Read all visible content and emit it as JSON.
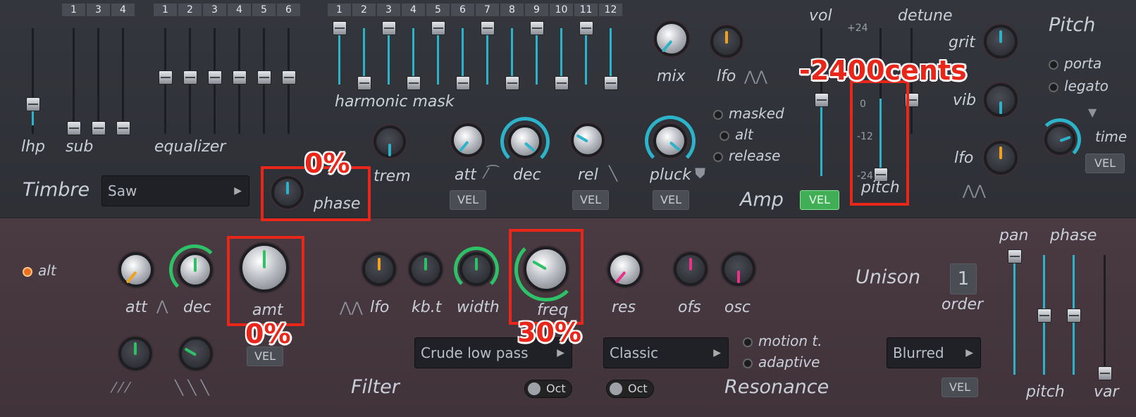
{
  "timbre": {
    "sliders": {
      "lhp": "lhp",
      "sub": "sub",
      "equalizer": "equalizer",
      "harmonic_mask": "harmonic mask"
    },
    "sub_numbers": [
      "1",
      "3",
      "4"
    ],
    "eq_numbers": [
      "1",
      "2",
      "3",
      "4",
      "5",
      "6"
    ],
    "mask_numbers": [
      "1",
      "2",
      "3",
      "4",
      "5",
      "6",
      "7",
      "8",
      "9",
      "10",
      "11",
      "12"
    ],
    "title": "Timbre",
    "waveform": "Saw",
    "phase_label": "phase",
    "trem_label": "trem",
    "mix_label": "mix",
    "lfo_label": "lfo"
  },
  "amp": {
    "title": "Amp",
    "att": "att",
    "dec": "dec",
    "rel": "rel",
    "pluck": "pluck",
    "vel": "VEL",
    "options": [
      "masked",
      "alt",
      "release"
    ],
    "vol": "vol",
    "detune": "detune",
    "pitch": "pitch",
    "scale": [
      "+24",
      "0",
      "-12",
      "-24"
    ]
  },
  "pitch_section": {
    "title": "Pitch",
    "grit": "grit",
    "vib": "vib",
    "lfo": "lfo",
    "porta": "porta",
    "legato": "legato",
    "time": "time",
    "vel": "VEL"
  },
  "filter": {
    "title": "Filter",
    "alt": "alt",
    "att": "att",
    "dec": "dec",
    "amt": "amt",
    "lfo": "lfo",
    "kbt": "kb.t",
    "width": "width",
    "freq": "freq",
    "res": "res",
    "ofs": "ofs",
    "osc": "osc",
    "type": "Crude low pass",
    "oct": "Oct",
    "vel": "VEL"
  },
  "resonance": {
    "title": "Resonance",
    "type": "Classic",
    "options": [
      "motion t.",
      "adaptive"
    ],
    "oct": "Oct"
  },
  "unison": {
    "title": "Unison",
    "order_value": "1",
    "order_label": "order",
    "mode": "Blurred",
    "vel": "VEL",
    "pan": "pan",
    "phase": "phase",
    "pitch": "pitch",
    "var": "var"
  },
  "annotations": {
    "phase": "0%",
    "amt": "0%",
    "freq": "30%",
    "pitch": "-2400cents"
  },
  "colors": {
    "accent": "#2db3c9",
    "highlight": "#e8261a",
    "vel_on": "#3fae55"
  }
}
